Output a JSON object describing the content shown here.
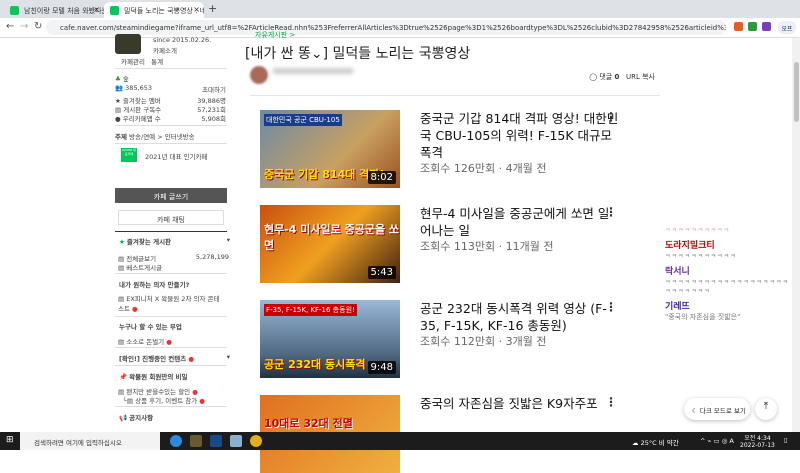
{
  "browser": {
    "tabs": [
      {
        "label": "남친이랑 모텔 처음 와봤다는 이"
      },
      {
        "label": "밀덕들 노리는 국뽕영상 : 네이버"
      }
    ],
    "url": "cafe.naver.com/steamindiegame?iframe_url_utf8=%2FArticleRead.nhn%253FreferrerAllArticles%3Dtrue%2526page%3D1%2526boardtype%3DL%2526clubid%3D27842958%2526articleid%3D6862313",
    "profile": "오프"
  },
  "sidebar": {
    "since": "since 2015.02.26.",
    "cafe_intro": "카페소개",
    "manage": "카페관리",
    "stats": "통계",
    "level": "숲",
    "members": "385,653",
    "invite": "초대하기",
    "fav_members_label": "즐겨찾는 멤버",
    "fav_members": "39,886명",
    "board_subs_label": "게시판 구독수",
    "board_subs": "57,231회",
    "cafe_app_label": "우리카페앱 수",
    "cafe_app": "5,908회",
    "theme_label": "주제",
    "theme": "방송/연예 > 인터넷방송",
    "badge": "NAVER 대표카페",
    "award": "2021년 대표 인기카페",
    "write": "카페 글쓰기",
    "chat": "카페 채팅",
    "fav_boards": "즐겨찾는 게시판",
    "all_posts": "전체글보기",
    "all_count": "5,278,199",
    "best": "베스트게시글",
    "chair": "내가 원하는 의자 만들기?",
    "chair_contest": "EX피니처 X 왁물원 2차 의자 콘테스트",
    "side_job": "누구나 할 수 있는 부업",
    "pocket": "소소로 돈벌기",
    "confirm": "[확인!] 진행중인 컨텐츠",
    "secret": "왁물원 회원만의 비밀",
    "discount": "왠치만 받을수있는 할인",
    "review": "상품 후기, 이벤트 참가",
    "notice": "공지사항"
  },
  "article": {
    "board": "자유게시판 >",
    "title": "[내가 싼 똥⌄] 밀덕들 노리는 국뽕영상",
    "comments_label": "댓글",
    "comments": "0",
    "url_copy": "URL 복사"
  },
  "videos": [
    {
      "title": "중국군 기갑 814대 격파 영상! 대한민국 CBU-105의 위력! F-15K 대규모 폭격",
      "meta": "조회수 126만회 · 4개월 전",
      "duration": "8:02",
      "tag": "대한민국 공군 CBU-105",
      "caption": "중국군 기갑 814대 격파!"
    },
    {
      "title": "현무-4 미사일을 중공군에게 쏘면 일어나는 일",
      "meta": "조회수 113만회 · 11개월 전",
      "duration": "5:43",
      "tag": "",
      "caption": "현무-4 미사일로 중공군을 쏘면"
    },
    {
      "title": "공군 232대 동시폭격 위력 영상 (F-35, F-15K, KF-16 총동원)",
      "meta": "조회수 112만회 · 3개월 전",
      "duration": "9:48",
      "tag": "F-35, F-15K, KF-16 총동원!",
      "caption": "공군 232대 동시폭격"
    },
    {
      "title": "중국의 자존심을 짓밟은 K9자주포",
      "meta": "",
      "duration": "",
      "tag": "",
      "caption": "10대로 32대 전멸"
    }
  ],
  "comments": [
    {
      "name": "도라지밀크티",
      "text": "ㅋㅋㅋㅋㅋㅋㅋㅋㅋㅋㅋ",
      "color": "#c00000"
    },
    {
      "name": "락서니",
      "text": "ㅋㅋㅋㅋㅋㅋㅋㅋㅋㅋㅋㅋㅋㅋㅋㅋㅋㅋㅋㅋㅋㅋㅋㅋㅋㅋ",
      "color": "#6a2aa0"
    },
    {
      "name": "기레뜨",
      "text": "\"중국의 자존심을 짓밟은\"",
      "color": "#3a2aa0"
    }
  ],
  "prev_comment_text": "ㅋㅋㅋㅋㅋㅋㅋㅋㅋㅋ",
  "dark_mode": "다크 모드로 보기",
  "taskbar": {
    "search": "검색하려면 여기에 입력하십시오",
    "weather": "25°C 비 약간",
    "time": "오전 4:34",
    "date": "2022-07-13"
  }
}
